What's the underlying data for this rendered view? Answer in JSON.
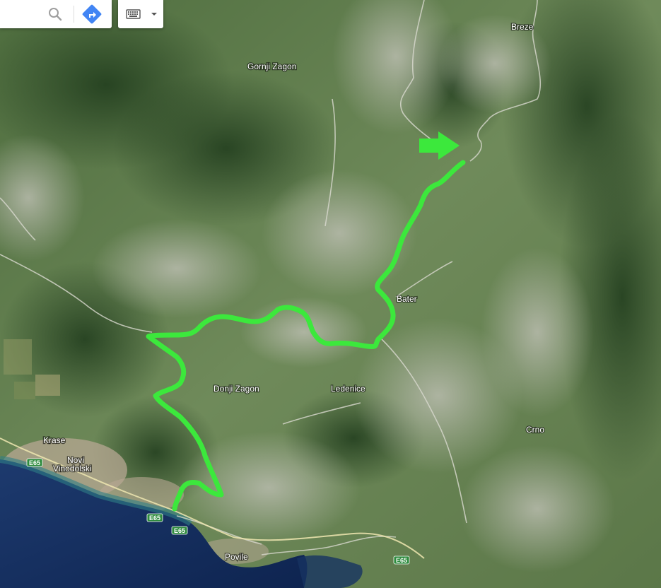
{
  "search": {
    "value": "",
    "placeholder": "",
    "search_icon": "search-icon",
    "directions_icon": "directions-icon"
  },
  "keyboard": {
    "icon": "keyboard-icon",
    "dropdown_icon": "chevron-down-icon"
  },
  "map": {
    "type": "satellite",
    "route_color": "#3ce83c",
    "arrow_color": "#3ce83c",
    "markers": [
      "arrow-marker"
    ],
    "places": {
      "breze": "Breze",
      "gornji_zagon": "Gornji Zagon",
      "bater": "Bater",
      "donji_zagon": "Donji Zagon",
      "ledenice": "Ledenice",
      "crno": "Crno",
      "krase": "Krase",
      "novi": "Novi",
      "vinodolski": "Vinodolski",
      "povile": "Povile"
    },
    "road_shields": {
      "e65_a": "E65",
      "e65_b": "E65",
      "e65_c": "E65",
      "e65_d": "E65"
    }
  }
}
